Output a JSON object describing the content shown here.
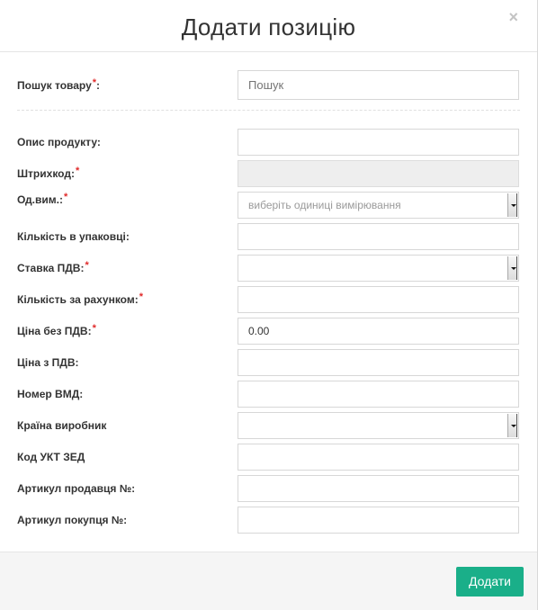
{
  "modal": {
    "title": "Додати позицію",
    "close_symbol": "×"
  },
  "search": {
    "label": "Пошук товару",
    "required_mark": "*",
    "suffix": ":",
    "placeholder": "Пошук"
  },
  "fields": {
    "description": {
      "label": "Опис продукту:",
      "value": ""
    },
    "barcode": {
      "label": "Штрихкод:",
      "required_mark": "*",
      "value": ""
    },
    "unit": {
      "label": "Од.вим.:",
      "required_mark": "*",
      "selected": "виберіть одиниці вимірювання"
    },
    "pack_qty": {
      "label": "Кількість в упаковці:",
      "value": ""
    },
    "vat_rate": {
      "label": "Ставка ПДВ:",
      "required_mark": "*",
      "selected": ""
    },
    "invoice_qty": {
      "label": "Кількість за рахунком:",
      "required_mark": "*",
      "value": ""
    },
    "price_no_vat": {
      "label": "Ціна без ПДВ:",
      "required_mark": "*",
      "value": "0.00"
    },
    "price_with_vat": {
      "label": "Ціна з ПДВ:",
      "value": ""
    },
    "vmd_number": {
      "label": "Номер ВМД:",
      "value": ""
    },
    "country": {
      "label": "Країна виробник",
      "selected": ""
    },
    "ukt_zed": {
      "label": "Код УКТ ЗЕД",
      "value": ""
    },
    "seller_article": {
      "label": "Артикул продавця №:",
      "value": ""
    },
    "buyer_article": {
      "label": "Артикул покупця №:",
      "value": ""
    }
  },
  "footer": {
    "submit_label": "Додати",
    "submit_color": "#1aaf89"
  }
}
